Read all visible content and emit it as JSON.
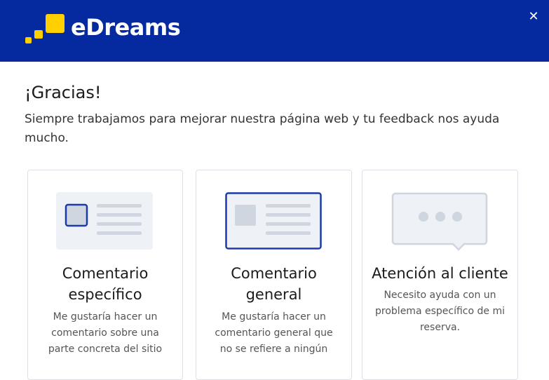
{
  "header": {
    "brand": "eDreams",
    "brand_color": "#05299f",
    "logo_accent_color": "#ffd000",
    "close_icon": "close-icon"
  },
  "main": {
    "title": "¡Gracias!",
    "subtitle": "Siempre trabajamos para mejorar nuestra página web y tu feedback nos ayuda mucho."
  },
  "cards": [
    {
      "icon": "specific-feedback-illustration",
      "title": "Comentario específico",
      "description": "Me gustaría hacer un comentario sobre una parte concreta del sitio"
    },
    {
      "icon": "general-feedback-illustration",
      "title": "Comentario general",
      "description": "Me gustaría hacer un comentario general que no se refiere a ningún"
    },
    {
      "icon": "chat-bubble-illustration",
      "title": "Atención al cliente",
      "description": "Necesito ayuda con un problema específico de mi reserva."
    }
  ]
}
